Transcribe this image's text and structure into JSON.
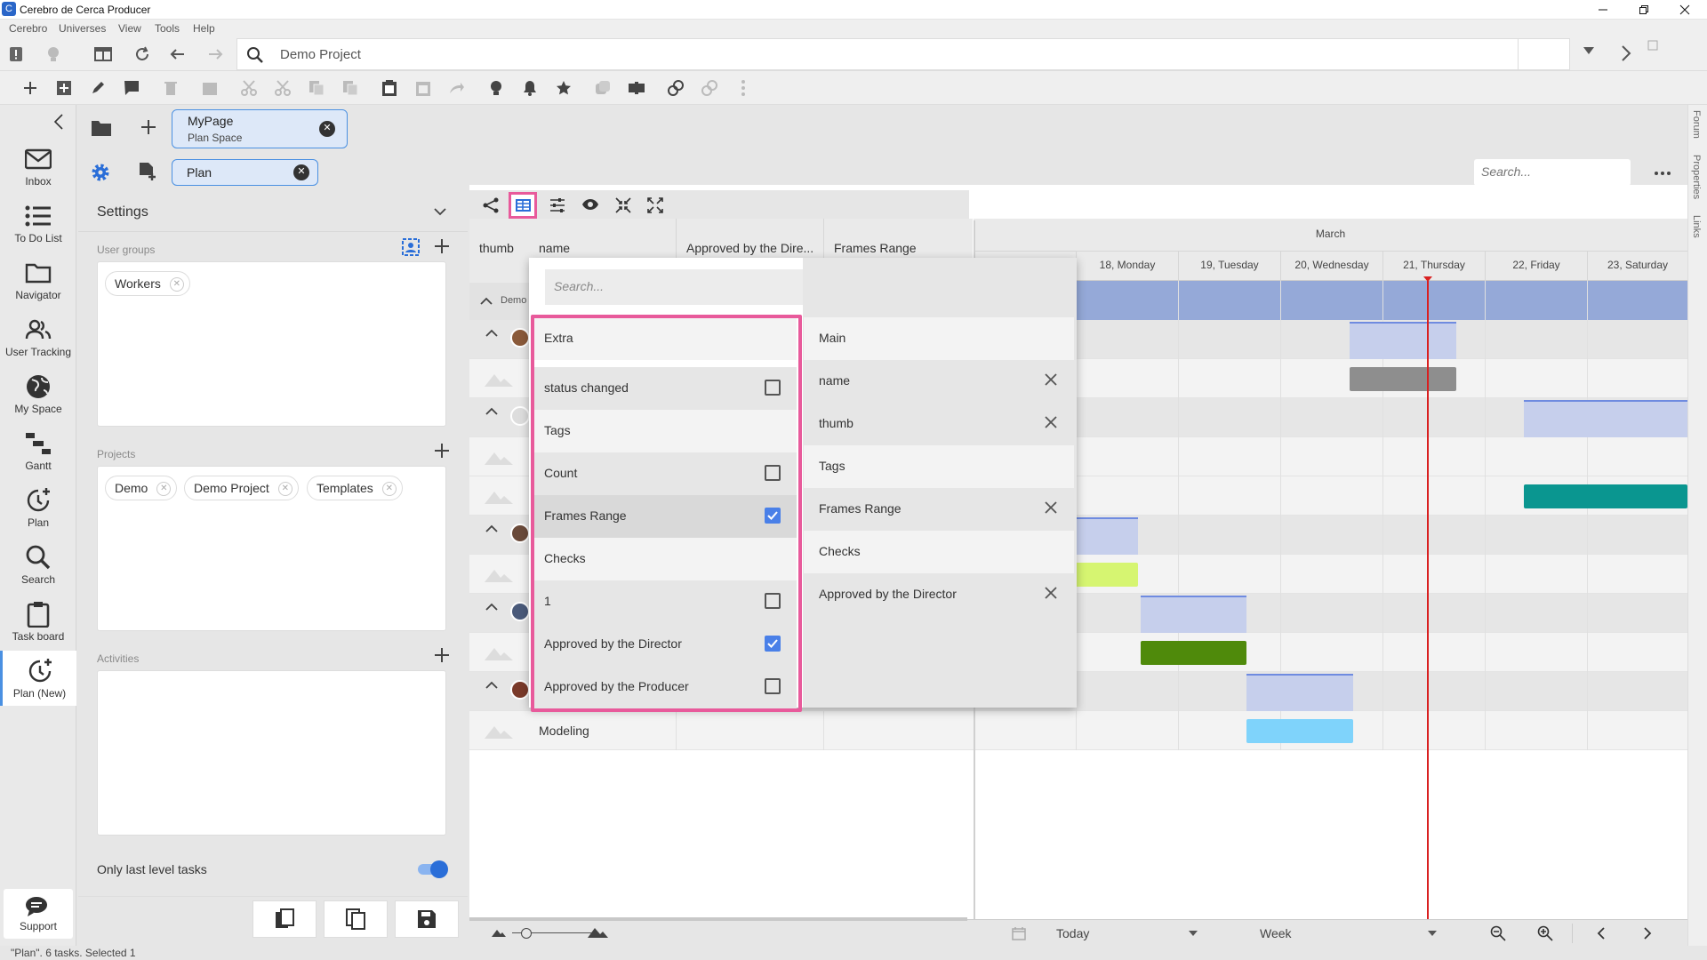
{
  "window": {
    "title": "Cerebro de Cerca  Producer"
  },
  "menu": [
    "Cerebro",
    "Universes",
    "View",
    "Tools",
    "Help"
  ],
  "address": {
    "value": "Demo Project"
  },
  "nav": [
    {
      "label": "Inbox",
      "icon": "mail-icon"
    },
    {
      "label": "To Do List",
      "icon": "list-icon"
    },
    {
      "label": "Navigator",
      "icon": "folder-icon"
    },
    {
      "label": "User Tracking",
      "icon": "users-icon"
    },
    {
      "label": "My Space",
      "icon": "globe-icon"
    },
    {
      "label": "Gantt",
      "icon": "gantt-icon"
    },
    {
      "label": "Plan",
      "icon": "clock-plus-icon"
    },
    {
      "label": "Search",
      "icon": "search-icon"
    },
    {
      "label": "Task board",
      "icon": "clipboard-icon"
    },
    {
      "label": "Plan (New)",
      "icon": "clock-plus-icon"
    }
  ],
  "support": {
    "label": "Support"
  },
  "tabs": {
    "page_title": "MyPage",
    "page_sub": "Plan Space",
    "plan": "Plan"
  },
  "search": {
    "placeholder": "Search..."
  },
  "settings": {
    "title": "Settings",
    "user_groups_label": "User groups",
    "user_groups": [
      "Workers"
    ],
    "projects_label": "Projects",
    "projects": [
      "Demo",
      "Demo Project",
      "Templates"
    ],
    "activities_label": "Activities",
    "only_last_label": "Only last level tasks",
    "only_last": true
  },
  "columns": {
    "thumb": "thumb",
    "name": "name",
    "approved": "Approved by the Dire...",
    "frames": "Frames Range"
  },
  "gantt": {
    "month": "March",
    "days": [
      "18, Monday",
      "19, Tuesday",
      "20, Wednesday",
      "21, Thursday",
      "22, Friday",
      "23, Saturday"
    ],
    "today_label": "Today",
    "scale": "Week"
  },
  "group_row": "Demo",
  "last_task": "Modeling",
  "popup": {
    "search_placeholder": "Search...",
    "left": [
      {
        "label": "Extra",
        "type": "header"
      },
      {
        "label": "status changed",
        "checked": false
      },
      {
        "label": "Tags",
        "type": "header"
      },
      {
        "label": "Count",
        "checked": false
      },
      {
        "label": "Frames Range",
        "checked": true
      },
      {
        "label": "Checks",
        "type": "header"
      },
      {
        "label": "1",
        "checked": false
      },
      {
        "label": "Approved by the Director",
        "checked": true
      },
      {
        "label": "Approved by the Producer",
        "checked": false
      }
    ],
    "right": [
      {
        "label": "Main",
        "type": "header"
      },
      {
        "label": "name",
        "removable": true
      },
      {
        "label": "thumb",
        "removable": true
      },
      {
        "label": "Tags",
        "type": "header"
      },
      {
        "label": "Frames Range",
        "removable": true
      },
      {
        "label": "Checks",
        "type": "header"
      },
      {
        "label": "Approved by the Director",
        "removable": true
      }
    ]
  },
  "side_tabs": [
    "Forum",
    "Properties",
    "Links"
  ],
  "status": {
    "text": "\"Plan\". 6 tasks. Selected 1"
  },
  "colors": {
    "accent": "#4a90e2",
    "highlight": "#e85a9b",
    "today": "#d92020",
    "teal": "#0a9690",
    "green": "#4f8a0b",
    "lime": "#d6f571",
    "sky": "#7fd3fb",
    "gray": "#8e8e8e",
    "lavender": "#c6cfec"
  }
}
